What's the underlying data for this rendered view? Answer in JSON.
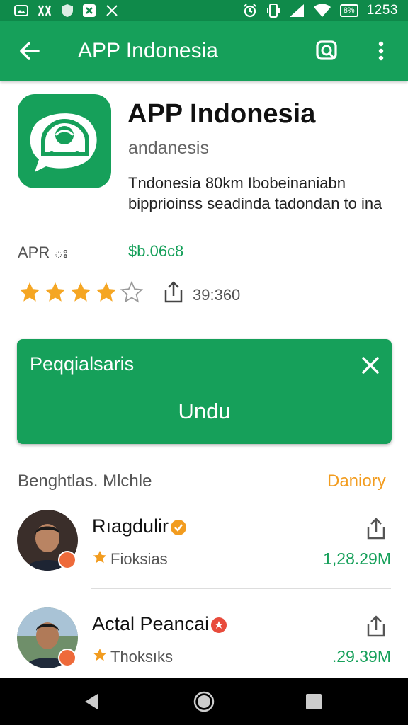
{
  "status_bar": {
    "time": "1253",
    "battery": "8%",
    "left_icons": [
      "gallery-icon",
      "bluetooth-icon",
      "shield-icon",
      "x-app-icon",
      "cross-icon"
    ],
    "right_icons": [
      "alarm-icon",
      "vibrate-icon",
      "signal-icon",
      "wifi-icon",
      "battery-icon"
    ]
  },
  "app_bar": {
    "title": "APP Indonesia",
    "back_icon": "arrow-left-icon",
    "search_icon": "search-icon",
    "more_icon": "more-vert-icon"
  },
  "app": {
    "name": "APP Indonesia",
    "developer": "andanesis",
    "description": "Tndonesia 80km Ibobeinaniabn bipprioinss seadinda tadondan to ina",
    "size_label": "APR ః",
    "price": "$b.06c8",
    "rating": 4,
    "rating_max": 5,
    "downloads": "39:360"
  },
  "banner": {
    "label": "Peqqialsaris",
    "action": "Undu"
  },
  "section": {
    "title": "Benghtlas. Mlchle",
    "action": "Daniory"
  },
  "items": [
    {
      "name": "Rıagdulir",
      "sub": "Fioksias",
      "value": "1,28.29M",
      "badge_color": "#f29c1f"
    },
    {
      "name": "Actal Peancai",
      "sub": "Thoksıks",
      "value": ".29.39M",
      "badge_color": "#e84b3c"
    }
  ],
  "colors": {
    "primary": "#16a05a",
    "status_bar": "#0f8a4a",
    "accent": "#f29c1f",
    "star": "#f5a623"
  }
}
